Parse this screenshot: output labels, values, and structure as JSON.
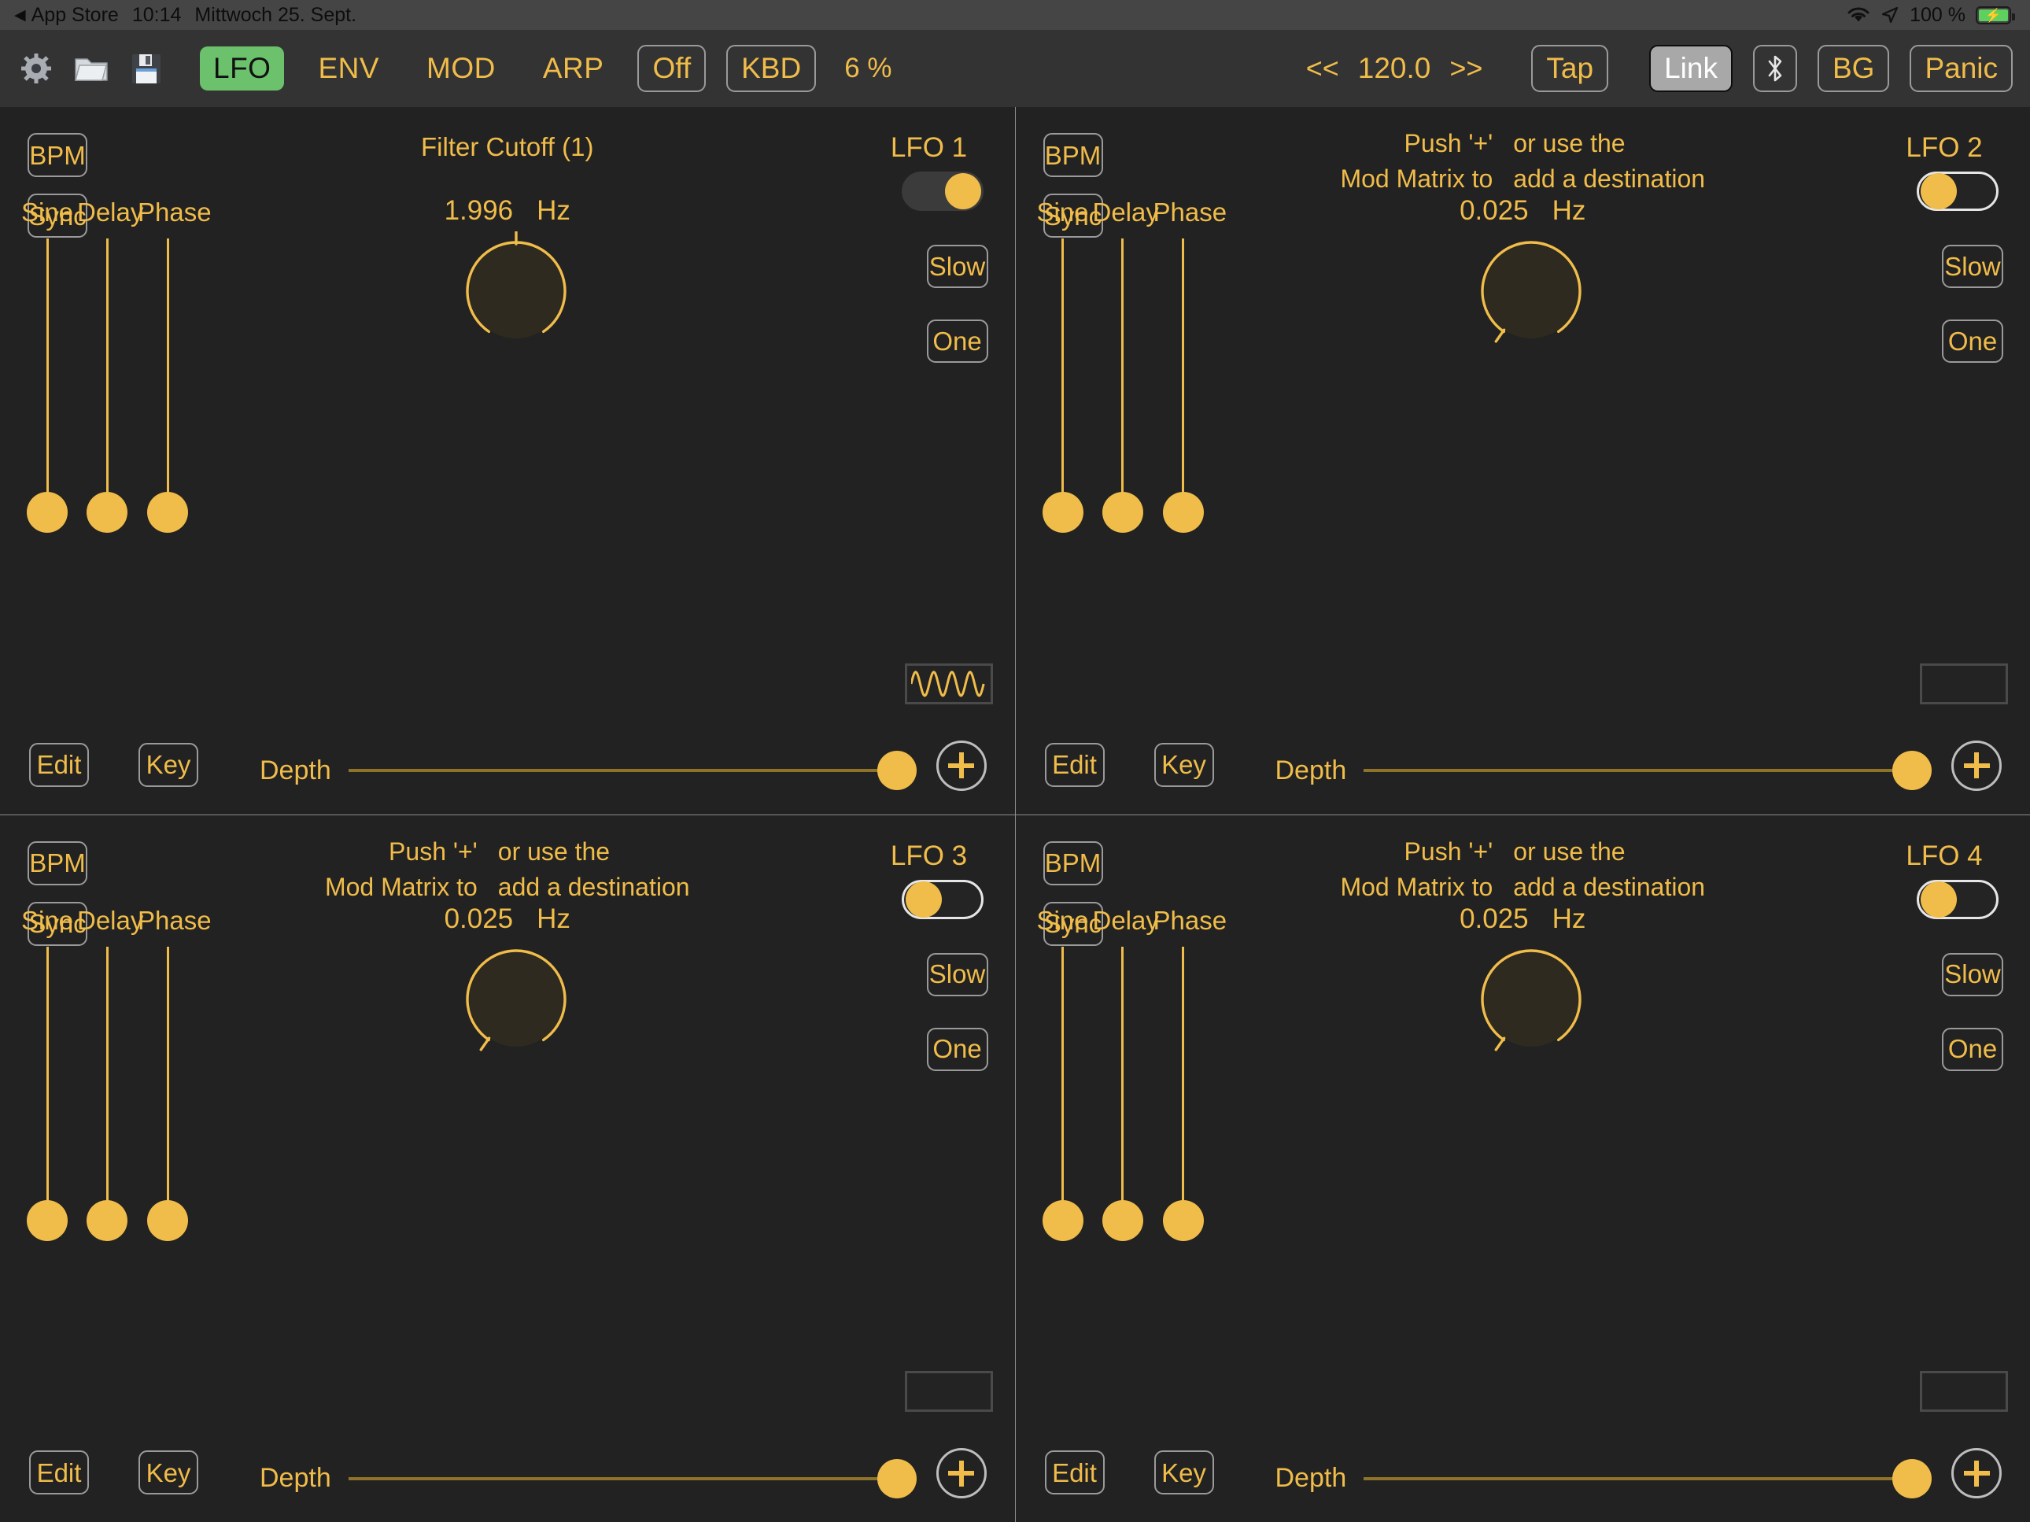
{
  "statusbar": {
    "back_app": "App Store",
    "back_arrow": "◀",
    "time": "10:14",
    "date": "Mittwoch 25. Sept.",
    "wifi_icon": "wifi-icon",
    "location_icon": "location-arrow-icon",
    "battery_percent": "100 %",
    "battery_icon": "battery-charging-icon",
    "accent": "#5ed05e"
  },
  "toolbar": {
    "settings_icon": "gear-icon",
    "open_icon": "folder-icon",
    "save_icon": "floppy-disk-icon",
    "tabs": [
      {
        "label": "LFO",
        "active": true
      },
      {
        "label": "ENV",
        "active": false
      },
      {
        "label": "MOD",
        "active": false
      },
      {
        "label": "ARP",
        "active": false
      }
    ],
    "off_button": "Off",
    "kbd_button": "KBD",
    "cpu_percent": "6 %",
    "tempo_prev": "<<",
    "tempo_value": "120.0",
    "tempo_next": ">>",
    "tap_button": "Tap",
    "link_button": "Link",
    "link_active": true,
    "bluetooth_icon": "bluetooth-icon",
    "bg_button": "BG",
    "panic_button": "Panic",
    "accent": "#f0bc4a",
    "active_tab_color": "#6cc16c"
  },
  "labels": {
    "bpm": "BPM",
    "sync": "Sync",
    "edit": "Edit",
    "key": "Key",
    "slow": "Slow",
    "one": "One",
    "depth": "Depth",
    "hz": "Hz",
    "plus": "+",
    "hint_line1_col1": "Push '+'",
    "hint_line2_col1": "Mod Matrix to",
    "hint_line1_col2": "or use the",
    "hint_line2_col2": "add a destination"
  },
  "lfos": [
    {
      "title": "LFO 1",
      "enabled": true,
      "destination": "Filter Cutoff (1)",
      "has_destination": true,
      "rate_value": "1.996",
      "rate_unit": "Hz",
      "knob_angle_deg": 0,
      "waveform_label": "Sine",
      "waveform_visible": true,
      "sliders": [
        {
          "label": "Sine",
          "value": 0
        },
        {
          "label": "Delay",
          "value": 0
        },
        {
          "label": "Phase",
          "value": 0
        }
      ],
      "depth_value": 100
    },
    {
      "title": "LFO 2",
      "enabled": false,
      "destination": "",
      "has_destination": false,
      "rate_value": "0.025",
      "rate_unit": "Hz",
      "knob_angle_deg": -145,
      "waveform_label": "Sine",
      "waveform_visible": false,
      "sliders": [
        {
          "label": "Sine",
          "value": 0
        },
        {
          "label": "Delay",
          "value": 0
        },
        {
          "label": "Phase",
          "value": 0
        }
      ],
      "depth_value": 100
    },
    {
      "title": "LFO 3",
      "enabled": false,
      "destination": "",
      "has_destination": false,
      "rate_value": "0.025",
      "rate_unit": "Hz",
      "knob_angle_deg": -145,
      "waveform_label": "Sine",
      "waveform_visible": false,
      "sliders": [
        {
          "label": "Sine",
          "value": 0
        },
        {
          "label": "Delay",
          "value": 0
        },
        {
          "label": "Phase",
          "value": 0
        }
      ],
      "depth_value": 100
    },
    {
      "title": "LFO 4",
      "enabled": false,
      "destination": "",
      "has_destination": false,
      "rate_value": "0.025",
      "rate_unit": "Hz",
      "knob_angle_deg": -145,
      "waveform_label": "Sine",
      "waveform_visible": false,
      "sliders": [
        {
          "label": "Sine",
          "value": 0
        },
        {
          "label": "Delay",
          "value": 0
        },
        {
          "label": "Phase",
          "value": 0
        }
      ],
      "depth_value": 100
    }
  ]
}
